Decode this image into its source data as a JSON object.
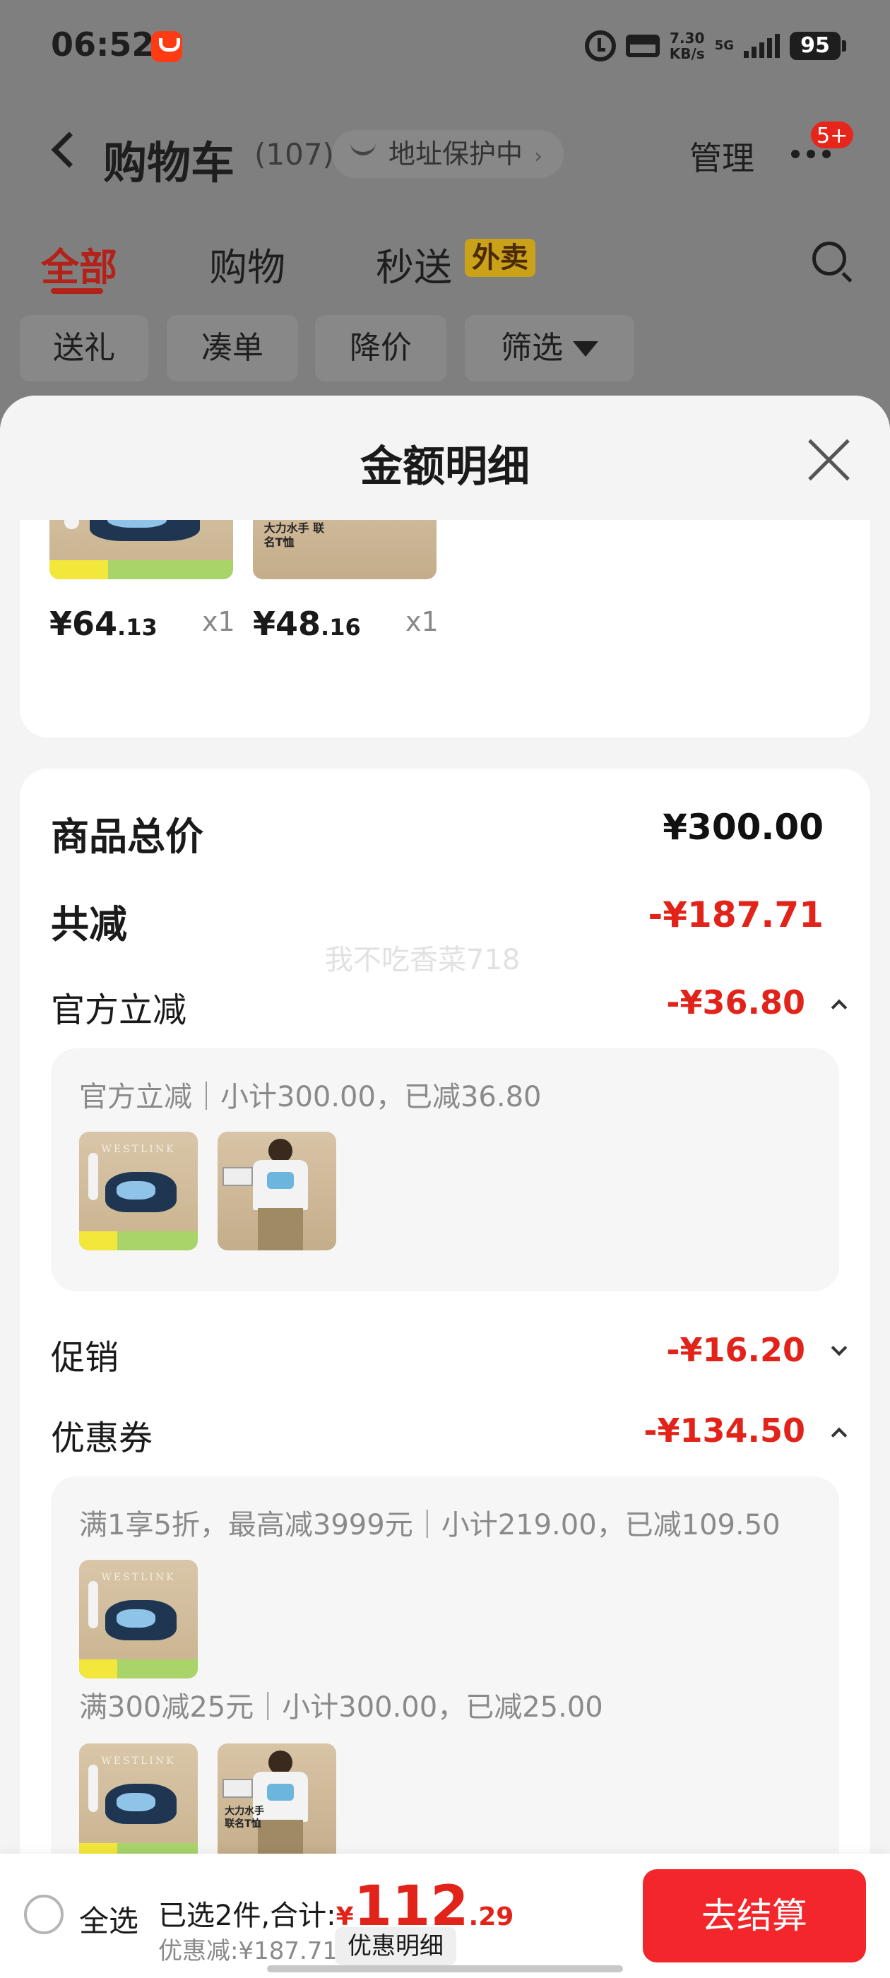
{
  "status_bar": {
    "time": "06:52",
    "net_speed_value": "7.30",
    "net_speed_unit": "KB/s",
    "network": "5G",
    "battery": "95"
  },
  "nav": {
    "title": "购物车",
    "count": "(107)",
    "address": "地址保护中",
    "address_chevron": "›",
    "manage": "管理",
    "badge": "5+"
  },
  "tabs": [
    {
      "label": "全部",
      "active": true
    },
    {
      "label": "购物"
    },
    {
      "label": "秒送"
    }
  ],
  "tab_tag": "外卖",
  "filters": [
    {
      "label": "送礼"
    },
    {
      "label": "凑单"
    },
    {
      "label": "降价"
    },
    {
      "label": "筛选"
    }
  ],
  "sheet": {
    "title": "金额明细",
    "items": [
      {
        "name": "shoe",
        "price_int": "¥64",
        "price_dec": ".13",
        "qty": "x1",
        "brand": "WESTLINK"
      },
      {
        "name": "tee",
        "price_int": "¥48",
        "price_dec": ".16",
        "qty": "x1",
        "caption": "大力水手 联名T恤"
      }
    ],
    "total_label": "商品总价",
    "total_value": "¥300.00",
    "reduce_label": "共减",
    "reduce_value": "-¥187.71",
    "watermark": "我不吃香菜718",
    "official_label": "官方立减",
    "official_value": "-¥36.80",
    "official_detail": "官方立减｜小计300.00，已减36.80",
    "promo_label": "促销",
    "promo_value": "-¥16.20",
    "coupon_label": "优惠券",
    "coupon_value": "-¥134.50",
    "coupon_detail_1": "满1享5折，最高减3999元｜小计219.00，已减109.50",
    "coupon_detail_2": "满300减25元｜小计300.00，已减25.00"
  },
  "footer": {
    "select_all": "全选",
    "selected_text": "已选2件,合计:",
    "currency": "¥",
    "amount_int": "112",
    "amount_dec": ".29",
    "discount_text": "优惠减:¥187.71",
    "detail_button": "优惠明细",
    "checkout": "去结算"
  },
  "colors": {
    "accent_red": "#e2231a",
    "checkout_red": "#f2262b",
    "tab_active": "#b32218"
  }
}
